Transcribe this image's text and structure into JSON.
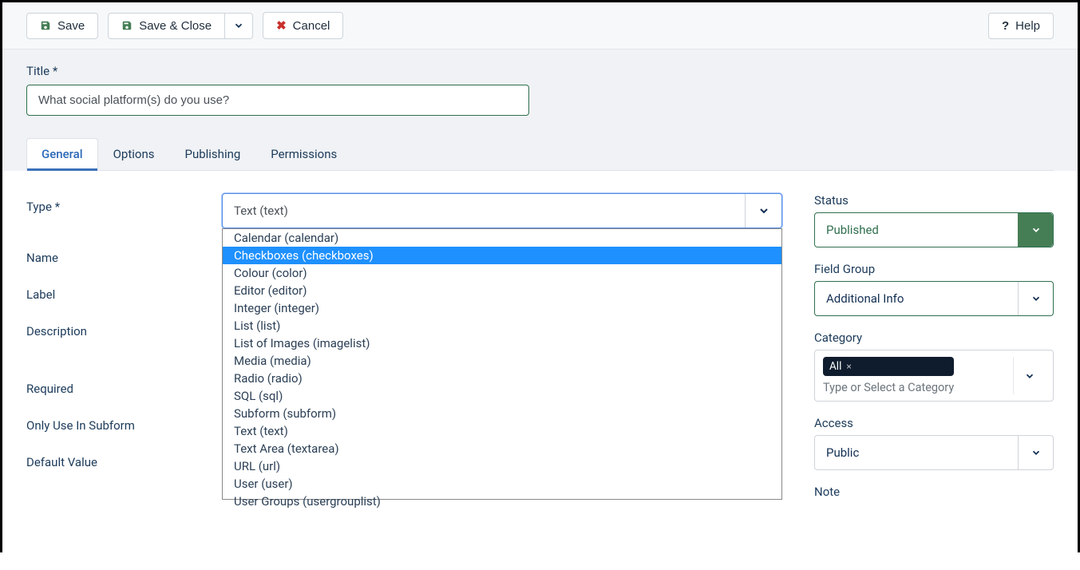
{
  "toolbar": {
    "save": "Save",
    "save_close": "Save & Close",
    "cancel": "Cancel",
    "help": "Help"
  },
  "title": {
    "label": "Title *",
    "value": "What social platform(s) do you use?"
  },
  "tabs": [
    "General",
    "Options",
    "Publishing",
    "Permissions"
  ],
  "active_tab": "General",
  "form": {
    "type_label": "Type *",
    "type_selected": "Text (text)",
    "type_options": [
      "Calendar (calendar)",
      "Checkboxes (checkboxes)",
      "Colour (color)",
      "Editor (editor)",
      "Integer (integer)",
      "List (list)",
      "List of Images (imagelist)",
      "Media (media)",
      "Radio (radio)",
      "SQL (sql)",
      "Subform (subform)",
      "Text (text)",
      "Text Area (textarea)",
      "URL (url)",
      "User (user)",
      "User Groups (usergrouplist)"
    ],
    "type_highlighted": "Checkboxes (checkboxes)",
    "name_label": "Name",
    "label_label": "Label",
    "description_label": "Description",
    "required_label": "Required",
    "subform_label": "Only Use In Subform",
    "default_label": "Default Value"
  },
  "sidebar": {
    "status_label": "Status",
    "status_value": "Published",
    "fieldgroup_label": "Field Group",
    "fieldgroup_value": "Additional Info",
    "category_label": "Category",
    "category_tag": "All",
    "category_placeholder": "Type or Select a Category",
    "access_label": "Access",
    "access_value": "Public",
    "note_label": "Note"
  }
}
